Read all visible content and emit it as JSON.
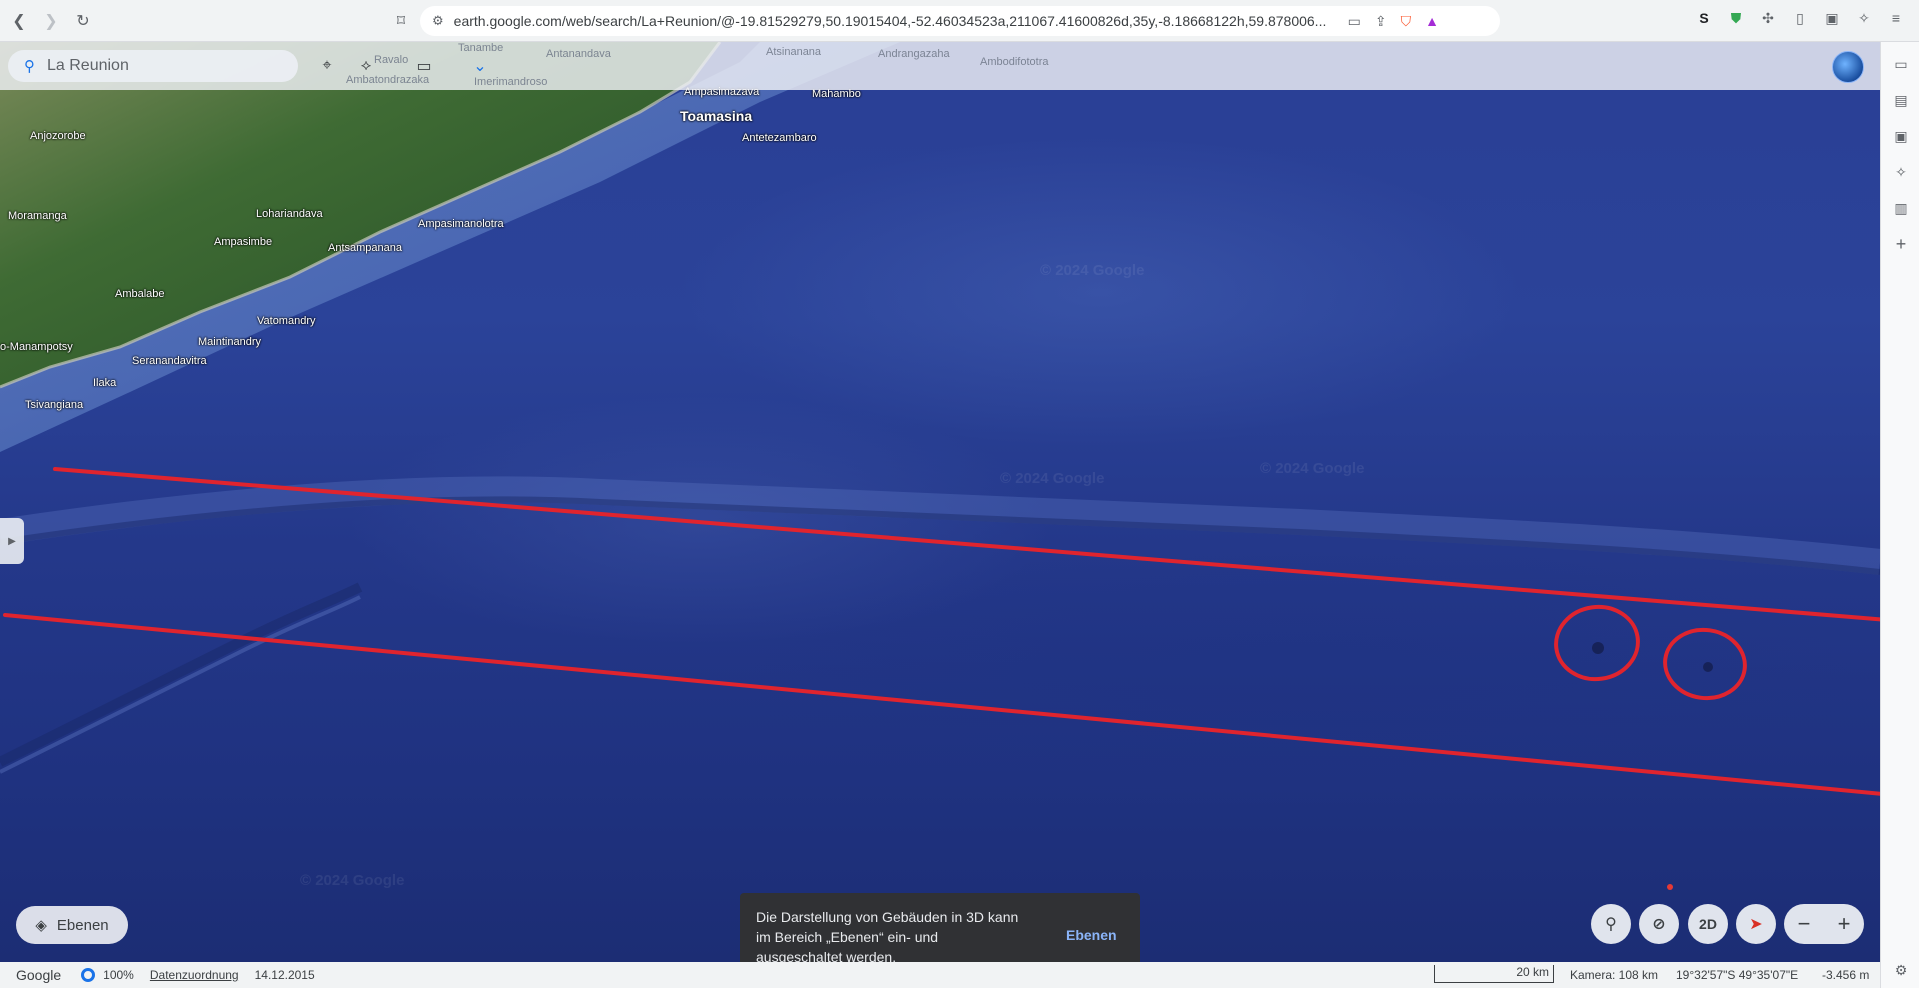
{
  "browser": {
    "url": "earth.google.com/web/search/La+Reunion/@-19.81529279,50.19015404,-52.46034523a,211067.41600826d,35y,-8.18668122h,59.878006..."
  },
  "search": {
    "value": "La Reunion"
  },
  "places": {
    "toamasina": "Toamasina",
    "antetezambaro": "Antetezambaro",
    "mahambo": "Mahambo",
    "ampasimazava": "Ampasimazava",
    "anjozorobe": "Anjozorobe",
    "moramanga": "Moramanga",
    "lohariandava": "Lohariandava",
    "ampasimanolotra": "Ampasimanolotra",
    "ampasimbe": "Ampasimbe",
    "antsampanana": "Antsampanana",
    "ambalabe": "Ambalabe",
    "vatomandry": "Vatomandry",
    "maintinandry": "Maintinandry",
    "manampotsy": "o-Manampotsy",
    "seranandavitra": "Seranandavitra",
    "ilaka": "Ilaka",
    "tsivangiana": "Tsivangiana",
    "antanandava": "Antanandava",
    "atsinanana": "Atsinanana",
    "andrangazaha": "Andrangazaha",
    "ambodifototra": "Ambodifototra",
    "ambatondrazaka": "Ambatondrazaka",
    "imerimandroso": "Imerimandroso",
    "tanambe": "Tanambe",
    "ravalo": "Ravalo"
  },
  "watermark": "© 2024 Google",
  "layers_button": {
    "label": "Ebenen"
  },
  "toast": {
    "message": "Die Darstellung von Gebäuden in 3D kann im Bereich „Ebenen“ ein- und ausgeschaltet werden.",
    "action": "Ebenen"
  },
  "controls": {
    "view_2d": "2D",
    "zoom_out": "−",
    "zoom_in": "+"
  },
  "status": {
    "brand": "Google",
    "percent": "100%",
    "attribution": "Datenzuordnung",
    "date": "14.12.2015",
    "scale": "20 km",
    "camera": "Kamera: 108 km",
    "coords": "19°32'57\"S 49°35'07\"E",
    "elevation": "-3.456 m"
  },
  "colors": {
    "annotation_red": "#e0242e",
    "ocean": "#2a3f95",
    "land": "#3f6b34"
  }
}
